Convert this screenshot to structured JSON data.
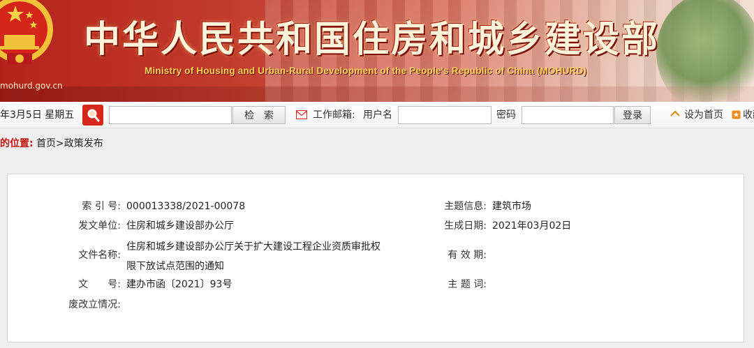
{
  "header": {
    "title_cn": "中华人民共和国住房和城乡建设部",
    "title_en": "Ministry of Housing and Urban-Rural Development of the People's Republic of China (MOHURD)",
    "site_url": "mohurd.gov.cn",
    "emblem_icon": "national-emblem-icon",
    "colors": {
      "banner_red": "#b3231a",
      "title_cream": "#fff3da",
      "subtitle_gold": "#ffd35c"
    }
  },
  "toolbar": {
    "date": "年3月5日 星期五",
    "search_icon": "magnifier-icon",
    "search_value": "",
    "search_button": "检　索",
    "mail_icon": "envelope-icon",
    "mail_label": "工作邮箱:",
    "username_label": "用户名",
    "username_value": "",
    "password_label": "密码",
    "password_value": "",
    "login_button": "登录",
    "home_icon": "home-icon",
    "set_home": "设为首页",
    "fav_icon": "bookmark-icon",
    "favorite": "收藏"
  },
  "breadcrumb": {
    "label": "的位置:",
    "path": "首页>政策发布",
    "accent": "#c4150c"
  },
  "doc_info": {
    "index_label": "索 引 号:",
    "index_value": "000013338/2021-00078",
    "issuer_label": "发文单位:",
    "issuer_value": "住房和城乡建设部办公厅",
    "filename_label": "文件名称:",
    "filename_value": "住房和城乡建设部办公厅关于扩大建设工程企业资质审批权限下放试点范围的通知",
    "docnum_label": "文　　号:",
    "docnum_value": "建办市函〔2021〕93号",
    "status_label": "废改立情况:",
    "status_value": "",
    "topic_label": "主题信息:",
    "topic_value": "建筑市场",
    "date_label": "生成日期:",
    "date_value": "2021年03月02日",
    "validity_label": "有 效 期:",
    "validity_value": "",
    "keywords_label": "主 题 词:",
    "keywords_value": ""
  }
}
